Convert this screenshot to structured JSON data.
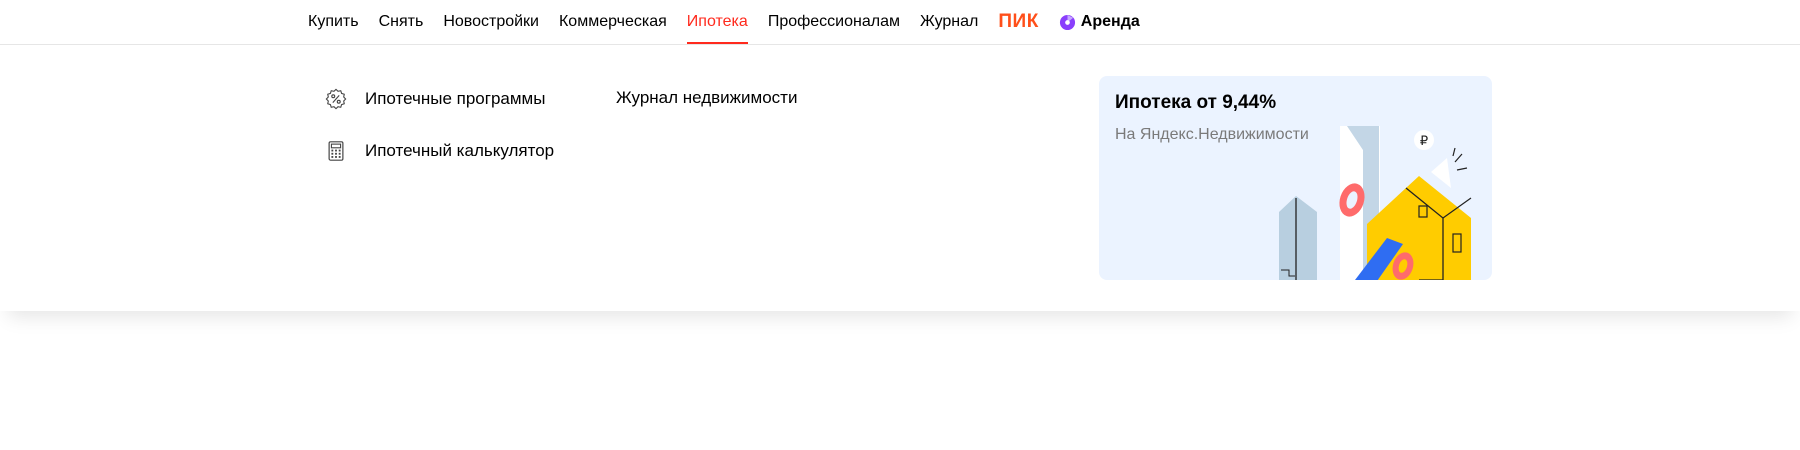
{
  "nav": {
    "items": [
      {
        "label": "Купить"
      },
      {
        "label": "Снять"
      },
      {
        "label": "Новостройки"
      },
      {
        "label": "Коммерческая"
      },
      {
        "label": "Ипотека"
      },
      {
        "label": "Профессионалам"
      },
      {
        "label": "Журнал"
      }
    ],
    "active_index": 4,
    "pik_label": "ПИК",
    "arenda_label": "Аренда",
    "active_color": "#ff2a1d",
    "pik_color": "#ff4f1a"
  },
  "dropdown": {
    "links": {
      "programs": {
        "label": "Ипотечные программы",
        "icon": "percent-badge-icon"
      },
      "calculator": {
        "label": "Ипотечный калькулятор",
        "icon": "calculator-icon"
      },
      "journal": {
        "label": "Журнал недвижимости"
      }
    },
    "promo": {
      "title": "Ипотека от 9,44%",
      "subtitle": "На Яндекс.Недвижимости",
      "background": "#ebf3ff"
    }
  }
}
